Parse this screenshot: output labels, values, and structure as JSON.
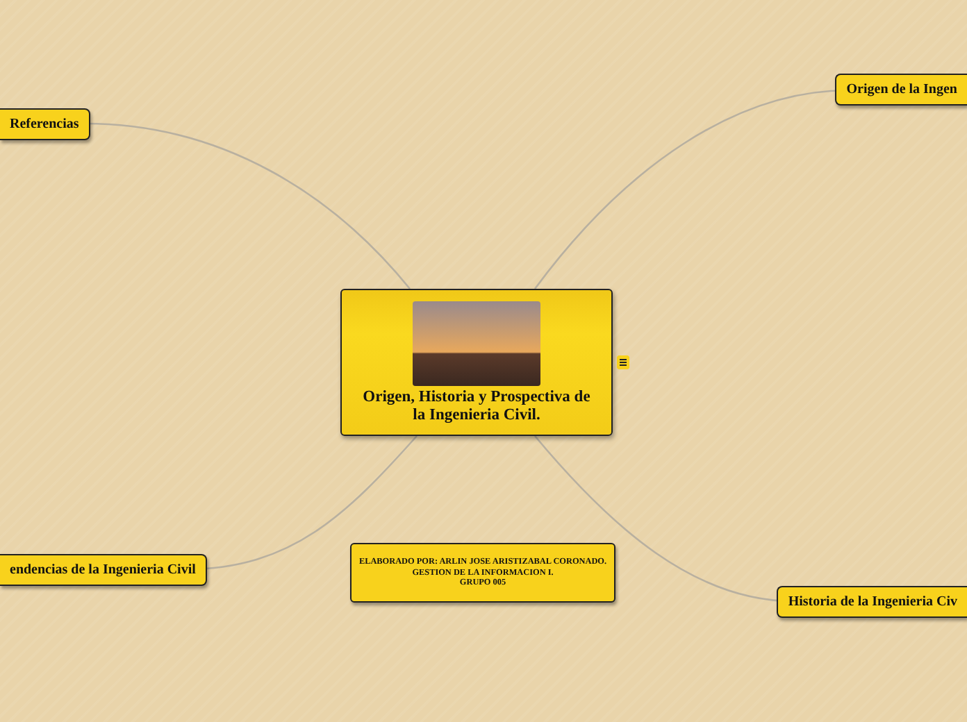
{
  "central_topic": {
    "title": "Origen, Historia y Prospectiva de la Ingenieria Civil.",
    "has_notes": true
  },
  "topics": [
    {
      "label": "Referencias"
    },
    {
      "label": "Origen de la Ingen"
    },
    {
      "label": "endencias de la Ingenieria Civil"
    },
    {
      "label": "Historia de la Ingenieria Civ"
    }
  ],
  "credits_note": {
    "lines": [
      "ELABORADO POR: ARLIN JOSE ARISTIZABAL CORONADO.",
      "GESTION DE LA INFORMACION I.",
      "GRUPO 005"
    ]
  }
}
